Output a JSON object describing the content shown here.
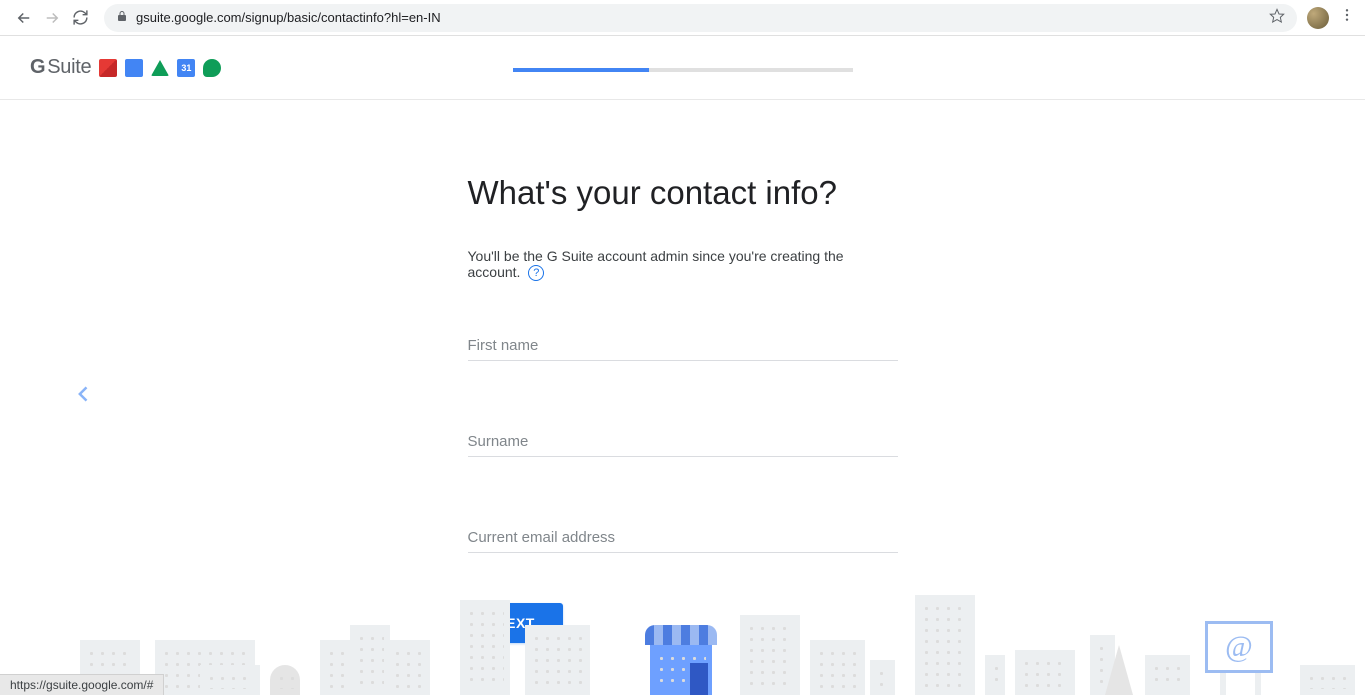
{
  "browser": {
    "url": "gsuite.google.com/signup/basic/contactinfo?hl=en-IN",
    "status_url": "https://gsuite.google.com/#"
  },
  "header": {
    "logo": "Suite",
    "calendar_day": "31",
    "progress_percent": 40
  },
  "page": {
    "title": "What's your contact info?",
    "subtitle": "You'll be the G Suite account admin since you're creating the account."
  },
  "form": {
    "first_name_placeholder": "First name",
    "surname_placeholder": "Surname",
    "email_placeholder": "Current email address",
    "next_label": "NEXT"
  }
}
